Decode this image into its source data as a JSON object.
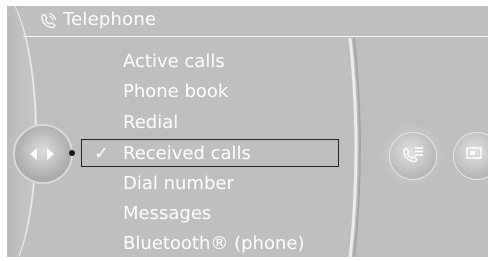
{
  "header": {
    "title": "Telephone",
    "icon": "phone-icon"
  },
  "menu": {
    "items": [
      {
        "label": "Active calls"
      },
      {
        "label": "Phone book"
      },
      {
        "label": "Redial"
      },
      {
        "label": "Received calls",
        "selected": true,
        "check": "✓"
      },
      {
        "label": "Dial number"
      },
      {
        "label": "Messages"
      },
      {
        "label": "Bluetooth® (phone)"
      }
    ]
  },
  "controller": {
    "icon": "controller-left-right-icon"
  },
  "side_buttons": [
    {
      "icon": "phone-menu-icon"
    },
    {
      "icon": "media-icon"
    }
  ],
  "colors": {
    "background": "#bdbebf",
    "text": "#ffffff",
    "highlight_border": "#222222"
  }
}
